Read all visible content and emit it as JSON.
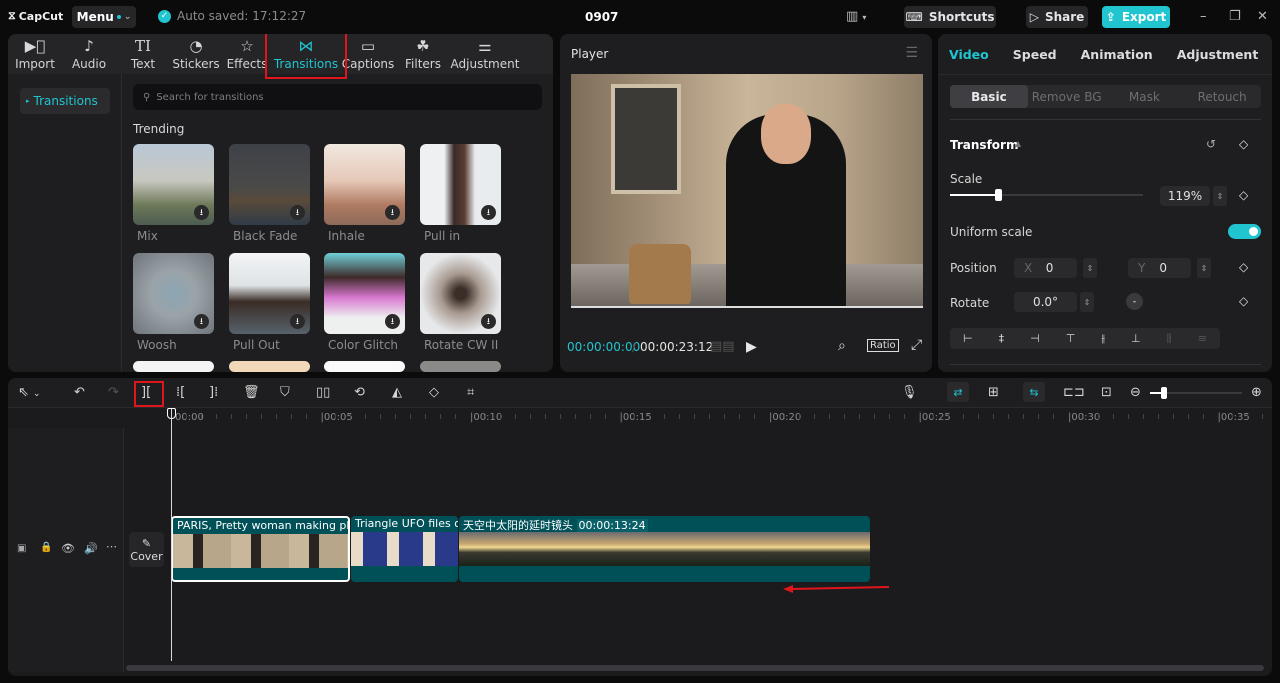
{
  "app": {
    "logo": "CapCut",
    "menu_label": "Menu",
    "autosave": "Auto saved: 17:12:27",
    "project_name": "0907"
  },
  "titlebar": {
    "shortcuts": "Shortcuts",
    "share": "Share",
    "export": "Export"
  },
  "toolbar": {
    "items": [
      {
        "label": "Import",
        "icon": "import-icon"
      },
      {
        "label": "Audio",
        "icon": "audio-icon"
      },
      {
        "label": "Text",
        "icon": "text-icon"
      },
      {
        "label": "Stickers",
        "icon": "sticker-icon"
      },
      {
        "label": "Effects",
        "icon": "effects-icon"
      },
      {
        "label": "Transitions",
        "icon": "transition-icon",
        "active": true
      },
      {
        "label": "Captions",
        "icon": "captions-icon"
      },
      {
        "label": "Filters",
        "icon": "filters-icon"
      },
      {
        "label": "Adjustment",
        "icon": "adjustment-icon"
      }
    ]
  },
  "sidebar": {
    "items": [
      {
        "label": "Transitions",
        "active": true
      }
    ]
  },
  "search": {
    "placeholder": "Search for transitions"
  },
  "trending": {
    "title": "Trending",
    "items": [
      {
        "label": "Mix"
      },
      {
        "label": "Black Fade"
      },
      {
        "label": "Inhale"
      },
      {
        "label": "Pull in"
      },
      {
        "label": "Woosh"
      },
      {
        "label": "Pull Out"
      },
      {
        "label": "Color Glitch"
      },
      {
        "label": "Rotate CW II"
      }
    ]
  },
  "player": {
    "title": "Player",
    "current_time": "00:00:00:00",
    "total_time": "00:00:23:12",
    "ratio_label": "Ratio"
  },
  "inspector": {
    "tabs": [
      "Video",
      "Speed",
      "Animation",
      "Adjustment"
    ],
    "active_tab": "Video",
    "subtabs": [
      "Basic",
      "Remove BG",
      "Mask",
      "Retouch"
    ],
    "section": "Transform",
    "scale_label": "Scale",
    "scale_value": "119%",
    "scale_fraction": 0.25,
    "uniform_label": "Uniform scale",
    "uniform_on": true,
    "position_label": "Position",
    "x_label": "X",
    "x_value": "0",
    "y_label": "Y",
    "y_value": "0",
    "rotate_label": "Rotate",
    "rotate_value": "0.0°"
  },
  "timeline": {
    "ruler": [
      "00:00",
      "00:05",
      "00:10",
      "00:15",
      "00:20",
      "00:25",
      "00:30",
      "00:35"
    ],
    "cover_label": "Cover",
    "clips": [
      {
        "title": "PARIS, Pretty woman making photo",
        "selected": true
      },
      {
        "title": "Triangle UFO files on"
      },
      {
        "title": "天空中太阳的延时镜头",
        "duration": "00:00:13:24"
      }
    ]
  },
  "colors": {
    "accent": "#20c5cf",
    "clip": "#005058",
    "highlight": "#e0161b"
  }
}
